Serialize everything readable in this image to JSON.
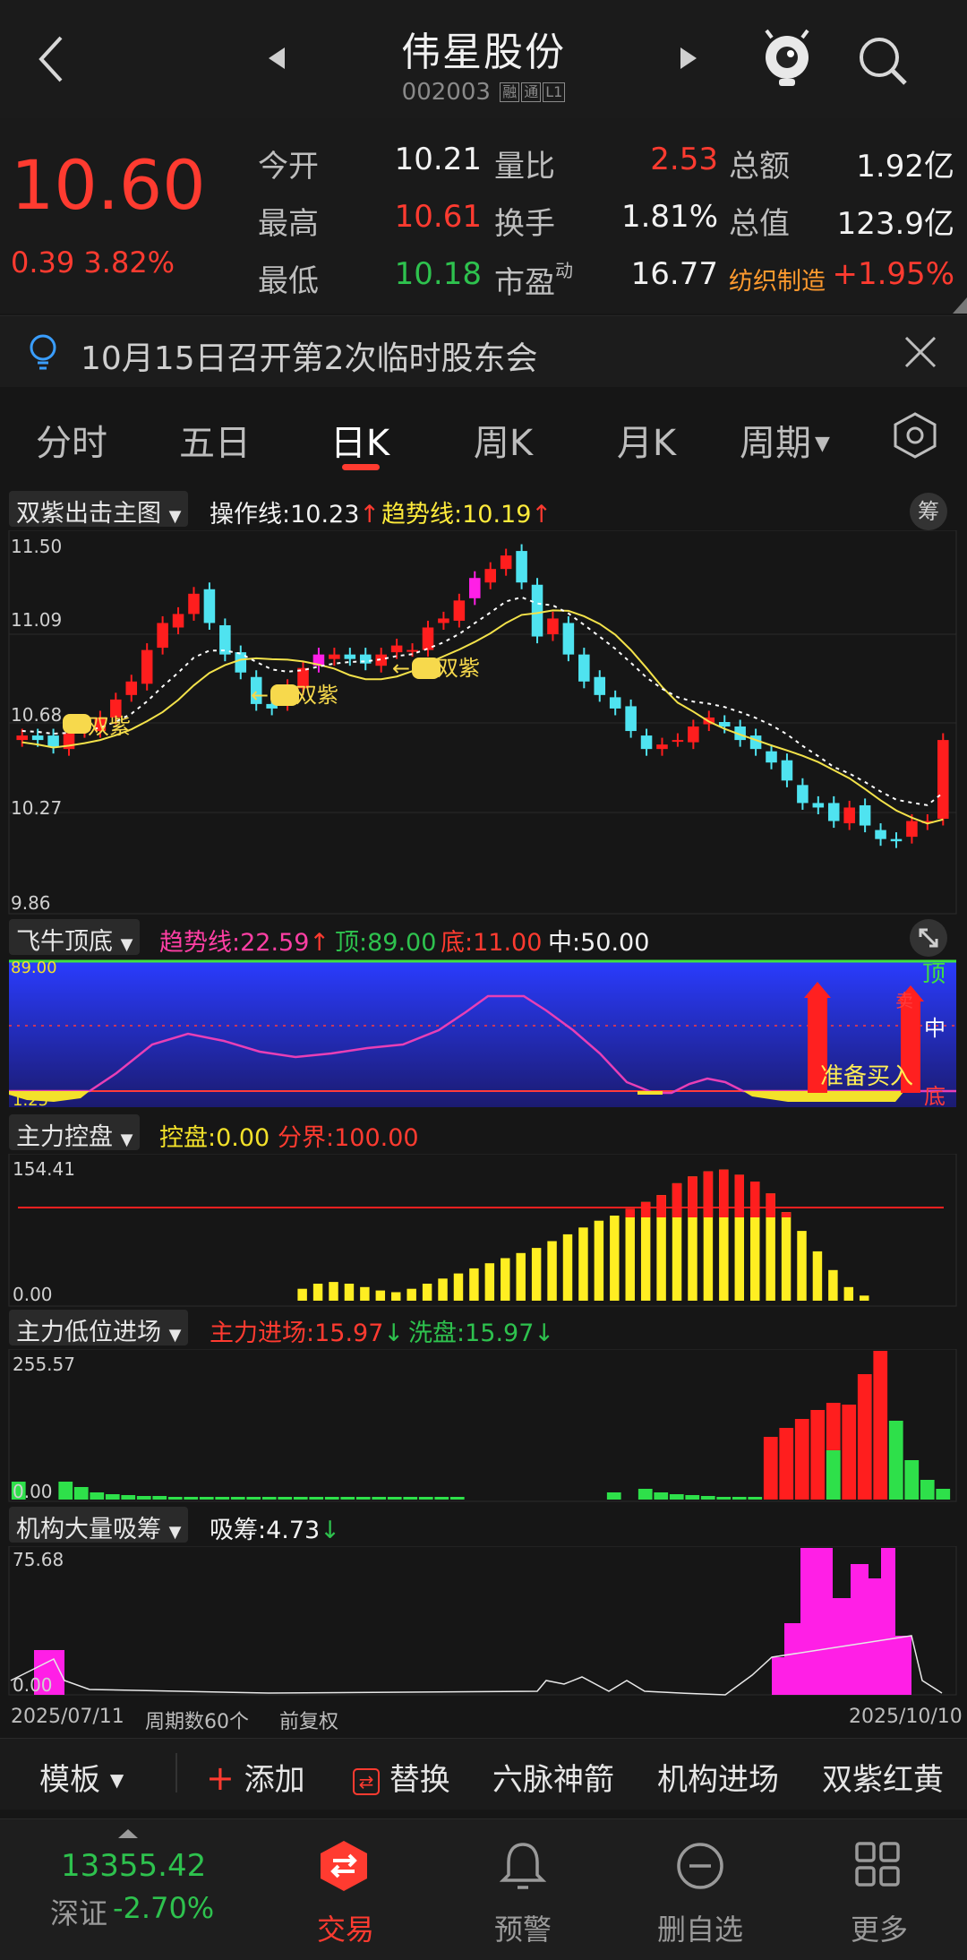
{
  "header": {
    "title": "伟星股份",
    "code": "002003",
    "tags": [
      "融",
      "通",
      "L1"
    ]
  },
  "quote": {
    "price": "10.60",
    "change": "0.39 3.82%",
    "rows": [
      {
        "l1": "今开",
        "v1": "10.21",
        "l2": "量比",
        "v2": "2.53",
        "l3": "总额",
        "v3": "1.92亿"
      },
      {
        "l1": "最高",
        "v1": "10.61",
        "l2": "换手",
        "v2": "1.81%",
        "l3": "总值",
        "v3": "123.9亿"
      },
      {
        "l1": "最低",
        "v1": "10.18",
        "l2": "市盈",
        "l2sup": "动",
        "v2": "16.77",
        "l3": "纺织制造",
        "v3": "+1.95%"
      }
    ]
  },
  "notice": {
    "text": "10月15日召开第2次临时股东会"
  },
  "tabs": [
    "分时",
    "五日",
    "日K",
    "周K",
    "月K",
    "周期"
  ],
  "indicators": {
    "main": {
      "name": "双紫出击主图",
      "op": "操作线:10.23",
      "trend": "趋势线:10.19",
      "chip": "筹",
      "yticks": [
        "11.50",
        "11.09",
        "10.68",
        "10.27",
        "9.86"
      ],
      "marks": [
        "双紫",
        "双紫",
        "双紫"
      ]
    },
    "feiniu": {
      "name": "飞牛顶底",
      "trend": "趋势线:22.59",
      "top": "顶:89.00",
      "bottom": "底:11.00",
      "mid": "中:50.00",
      "ymax": "89.00",
      "ymin": "1.25",
      "label_top": "顶",
      "label_mid": "中",
      "label_bottom": "底",
      "prepare": "准备买入",
      "sell": "卖"
    },
    "control": {
      "name": "主力控盘",
      "ctrl": "控盘:0.00",
      "boundary": "分界:100.00",
      "ymax": "154.41",
      "ymin": "0.00"
    },
    "lowpos": {
      "name": "主力低位进场",
      "enter": "主力进场:15.97",
      "wash": "洗盘:15.97",
      "ymax": "255.57",
      "ymin": "0.00"
    },
    "absorb": {
      "name": "机构大量吸筹",
      "absorb": "吸筹:4.73",
      "ymax": "75.68",
      "ymin": "0.00"
    }
  },
  "chart_footer": {
    "start": "2025/07/11",
    "count": "周期数60个",
    "adjust": "前复权",
    "end": "2025/10/10"
  },
  "toolbar": {
    "template": "模板",
    "add": "添加",
    "replace": "替换",
    "items": [
      "六脉神箭",
      "机构进场",
      "双紫红黄"
    ]
  },
  "index": {
    "value": "13355.42",
    "name": "深证",
    "change": "-2.70%"
  },
  "nav": [
    "交易",
    "预警",
    "删自选",
    "更多"
  ],
  "chart_data": {
    "type": "candlestick",
    "title": "伟星股份 日K",
    "ylim": [
      9.86,
      11.5
    ],
    "x": [
      "2025/07/11",
      "2025/10/10"
    ],
    "series": [
      {
        "name": "close",
        "values": [
          10.62,
          10.6,
          10.57,
          10.63,
          10.66,
          10.7,
          10.78,
          10.86,
          11.0,
          11.12,
          11.16,
          11.25,
          11.12,
          10.98,
          10.9,
          10.76,
          10.74,
          10.84,
          10.92,
          10.98,
          10.98,
          10.96,
          10.94,
          10.98,
          11.02,
          11.0,
          11.1,
          11.14,
          11.22,
          11.32,
          11.36,
          11.42,
          11.3,
          11.06,
          11.14,
          10.98,
          10.86,
          10.8,
          10.74,
          10.64,
          10.56,
          10.58,
          10.6,
          10.66,
          10.7,
          10.66,
          10.6,
          10.56,
          10.5,
          10.42,
          10.32,
          10.3,
          10.24,
          10.3,
          10.22,
          10.16,
          10.15,
          10.24,
          10.24,
          10.6
        ]
      },
      {
        "name": "操作线",
        "values": [
          10.23
        ]
      },
      {
        "name": "趋势线",
        "values": [
          10.19
        ]
      }
    ]
  }
}
